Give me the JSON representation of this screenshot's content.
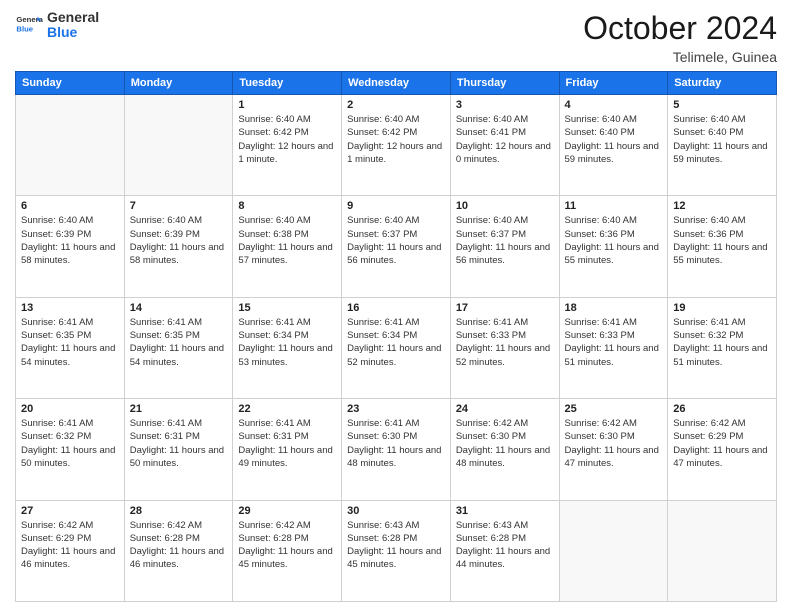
{
  "header": {
    "logo_line1": "General",
    "logo_line2": "Blue",
    "month_title": "October 2024",
    "location": "Telimele, Guinea"
  },
  "weekdays": [
    "Sunday",
    "Monday",
    "Tuesday",
    "Wednesday",
    "Thursday",
    "Friday",
    "Saturday"
  ],
  "weeks": [
    [
      {
        "day": "",
        "empty": true
      },
      {
        "day": "",
        "empty": true
      },
      {
        "day": "1",
        "sunrise": "6:40 AM",
        "sunset": "6:42 PM",
        "daylight": "12 hours and 1 minute."
      },
      {
        "day": "2",
        "sunrise": "6:40 AM",
        "sunset": "6:42 PM",
        "daylight": "12 hours and 1 minute."
      },
      {
        "day": "3",
        "sunrise": "6:40 AM",
        "sunset": "6:41 PM",
        "daylight": "12 hours and 0 minutes."
      },
      {
        "day": "4",
        "sunrise": "6:40 AM",
        "sunset": "6:40 PM",
        "daylight": "11 hours and 59 minutes."
      },
      {
        "day": "5",
        "sunrise": "6:40 AM",
        "sunset": "6:40 PM",
        "daylight": "11 hours and 59 minutes."
      }
    ],
    [
      {
        "day": "6",
        "sunrise": "6:40 AM",
        "sunset": "6:39 PM",
        "daylight": "11 hours and 58 minutes."
      },
      {
        "day": "7",
        "sunrise": "6:40 AM",
        "sunset": "6:39 PM",
        "daylight": "11 hours and 58 minutes."
      },
      {
        "day": "8",
        "sunrise": "6:40 AM",
        "sunset": "6:38 PM",
        "daylight": "11 hours and 57 minutes."
      },
      {
        "day": "9",
        "sunrise": "6:40 AM",
        "sunset": "6:37 PM",
        "daylight": "11 hours and 56 minutes."
      },
      {
        "day": "10",
        "sunrise": "6:40 AM",
        "sunset": "6:37 PM",
        "daylight": "11 hours and 56 minutes."
      },
      {
        "day": "11",
        "sunrise": "6:40 AM",
        "sunset": "6:36 PM",
        "daylight": "11 hours and 55 minutes."
      },
      {
        "day": "12",
        "sunrise": "6:40 AM",
        "sunset": "6:36 PM",
        "daylight": "11 hours and 55 minutes."
      }
    ],
    [
      {
        "day": "13",
        "sunrise": "6:41 AM",
        "sunset": "6:35 PM",
        "daylight": "11 hours and 54 minutes."
      },
      {
        "day": "14",
        "sunrise": "6:41 AM",
        "sunset": "6:35 PM",
        "daylight": "11 hours and 54 minutes."
      },
      {
        "day": "15",
        "sunrise": "6:41 AM",
        "sunset": "6:34 PM",
        "daylight": "11 hours and 53 minutes."
      },
      {
        "day": "16",
        "sunrise": "6:41 AM",
        "sunset": "6:34 PM",
        "daylight": "11 hours and 52 minutes."
      },
      {
        "day": "17",
        "sunrise": "6:41 AM",
        "sunset": "6:33 PM",
        "daylight": "11 hours and 52 minutes."
      },
      {
        "day": "18",
        "sunrise": "6:41 AM",
        "sunset": "6:33 PM",
        "daylight": "11 hours and 51 minutes."
      },
      {
        "day": "19",
        "sunrise": "6:41 AM",
        "sunset": "6:32 PM",
        "daylight": "11 hours and 51 minutes."
      }
    ],
    [
      {
        "day": "20",
        "sunrise": "6:41 AM",
        "sunset": "6:32 PM",
        "daylight": "11 hours and 50 minutes."
      },
      {
        "day": "21",
        "sunrise": "6:41 AM",
        "sunset": "6:31 PM",
        "daylight": "11 hours and 50 minutes."
      },
      {
        "day": "22",
        "sunrise": "6:41 AM",
        "sunset": "6:31 PM",
        "daylight": "11 hours and 49 minutes."
      },
      {
        "day": "23",
        "sunrise": "6:41 AM",
        "sunset": "6:30 PM",
        "daylight": "11 hours and 48 minutes."
      },
      {
        "day": "24",
        "sunrise": "6:42 AM",
        "sunset": "6:30 PM",
        "daylight": "11 hours and 48 minutes."
      },
      {
        "day": "25",
        "sunrise": "6:42 AM",
        "sunset": "6:30 PM",
        "daylight": "11 hours and 47 minutes."
      },
      {
        "day": "26",
        "sunrise": "6:42 AM",
        "sunset": "6:29 PM",
        "daylight": "11 hours and 47 minutes."
      }
    ],
    [
      {
        "day": "27",
        "sunrise": "6:42 AM",
        "sunset": "6:29 PM",
        "daylight": "11 hours and 46 minutes."
      },
      {
        "day": "28",
        "sunrise": "6:42 AM",
        "sunset": "6:28 PM",
        "daylight": "11 hours and 46 minutes."
      },
      {
        "day": "29",
        "sunrise": "6:42 AM",
        "sunset": "6:28 PM",
        "daylight": "11 hours and 45 minutes."
      },
      {
        "day": "30",
        "sunrise": "6:43 AM",
        "sunset": "6:28 PM",
        "daylight": "11 hours and 45 minutes."
      },
      {
        "day": "31",
        "sunrise": "6:43 AM",
        "sunset": "6:28 PM",
        "daylight": "11 hours and 44 minutes."
      },
      {
        "day": "",
        "empty": true
      },
      {
        "day": "",
        "empty": true
      }
    ]
  ]
}
